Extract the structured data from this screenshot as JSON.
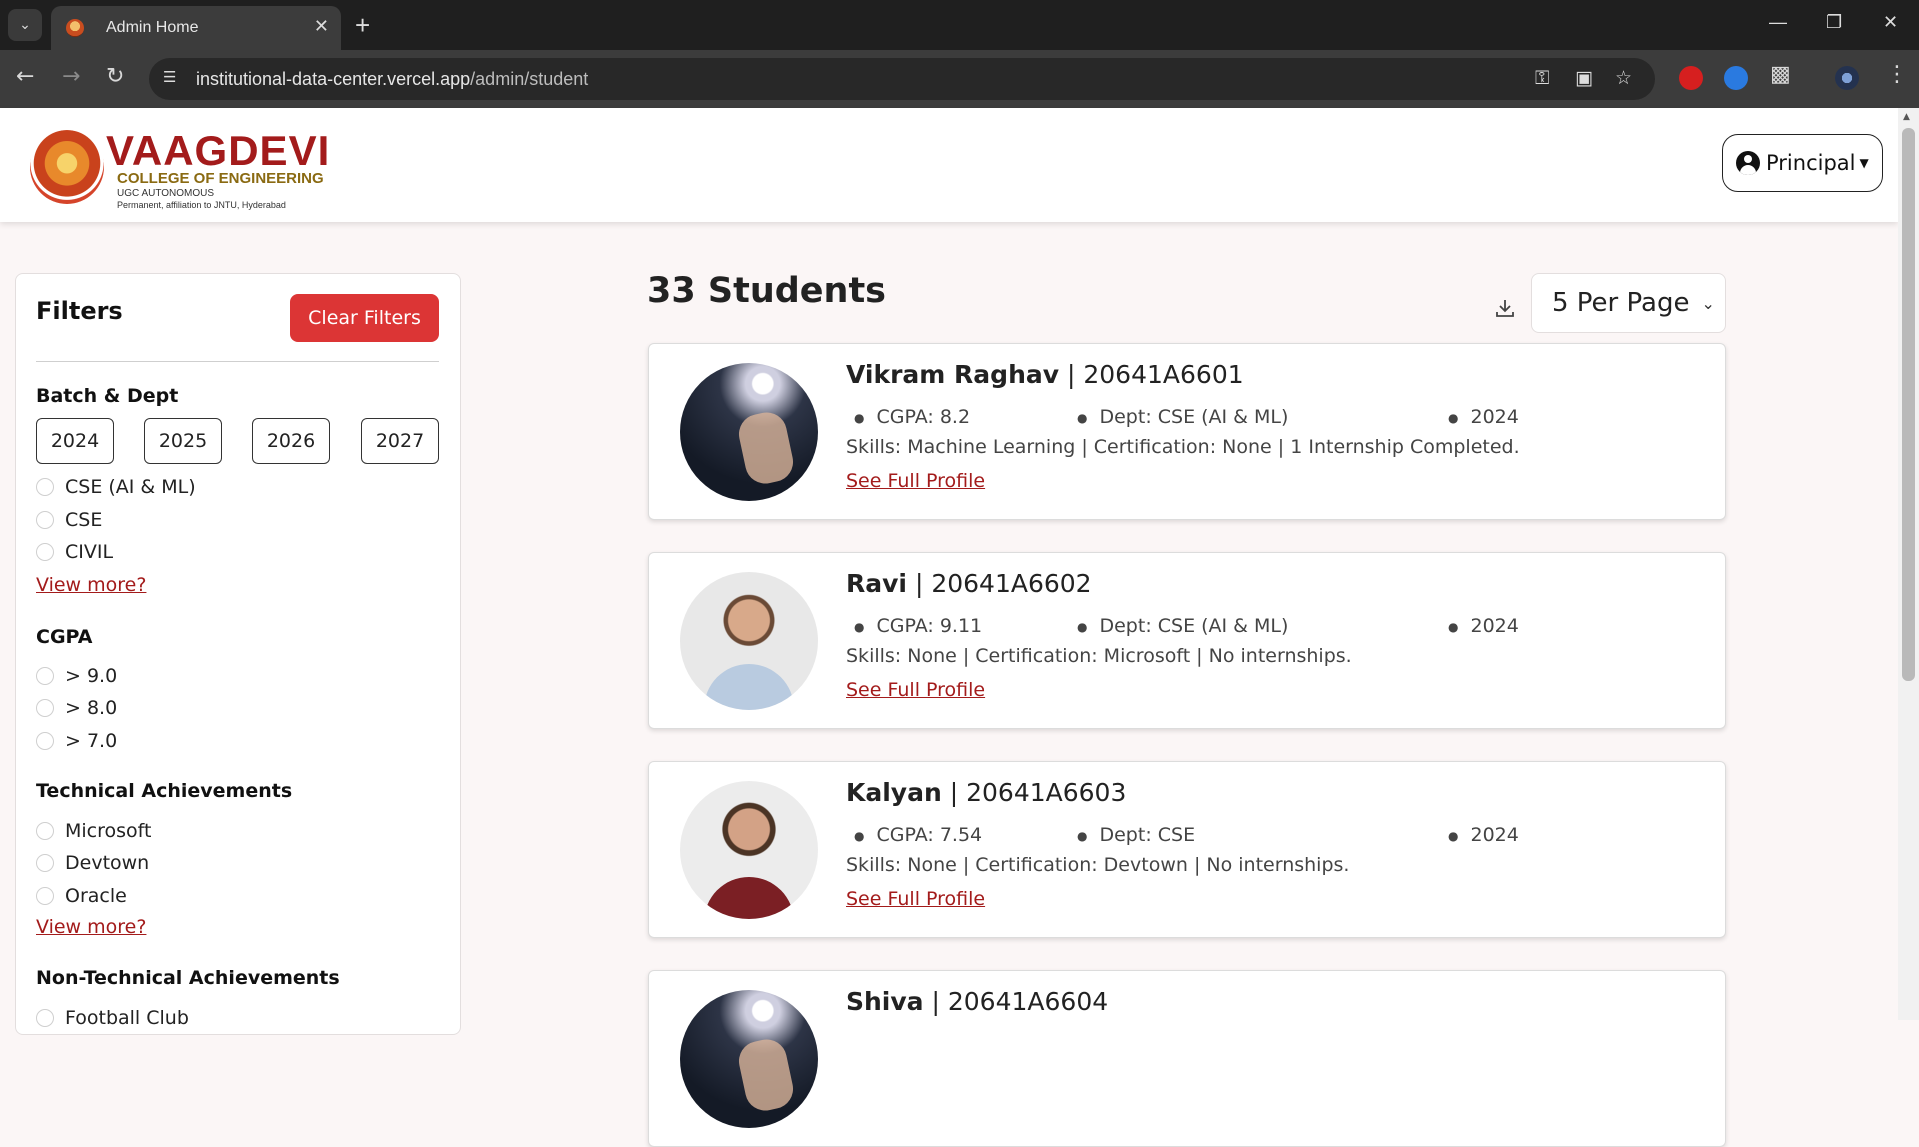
{
  "browser": {
    "tab_title": "Admin Home",
    "url_domain": "institutional-data-center.vercel.app",
    "url_path": "/admin/student"
  },
  "header": {
    "logo_title": "VAAGDEVI",
    "logo_subtitle": "COLLEGE OF ENGINEERING",
    "logo_ugc": "UGC AUTONOMOUS",
    "logo_affiliation": "Permanent, affiliation to JNTU, Hyderabad",
    "user_menu_label": "Principal"
  },
  "filters": {
    "title": "Filters",
    "clear_label": "Clear Filters",
    "batch_title": "Batch & Dept",
    "years": [
      "2024",
      "2025",
      "2026",
      "2027"
    ],
    "depts": [
      "CSE (AI & ML)",
      "CSE",
      "CIVIL"
    ],
    "view_more": "View more?",
    "cgpa_title": "CGPA",
    "cgpa_options": [
      "> 9.0",
      "> 8.0",
      "> 7.0"
    ],
    "tech_title": "Technical Achievements",
    "tech_options": [
      "Microsoft",
      "Devtown",
      "Oracle"
    ],
    "nontech_title": "Non-Technical Achievements",
    "nontech_options": [
      "Football Club"
    ]
  },
  "main": {
    "count_label": "33 Students",
    "per_page_label": "5 Per Page",
    "profile_link": "See Full Profile",
    "students": [
      {
        "name": "Vikram Raghav",
        "roll": "20641A6601",
        "cgpa": "CGPA: 8.2",
        "dept": "Dept: CSE (AI & ML)",
        "year": "2024",
        "details": "Skills: Machine Learning | Certification: None | 1 Internship Completed."
      },
      {
        "name": "Ravi",
        "roll": "20641A6602",
        "cgpa": "CGPA: 9.11",
        "dept": "Dept: CSE (AI & ML)",
        "year": "2024",
        "details": "Skills: None | Certification: Microsoft | No internships."
      },
      {
        "name": "Kalyan",
        "roll": "20641A6603",
        "cgpa": "CGPA: 7.54",
        "dept": "Dept: CSE",
        "year": "2024",
        "details": "Skills: None | Certification: Devtown | No internships."
      },
      {
        "name": "Shiva",
        "roll": "20641A6604"
      }
    ]
  },
  "colors": {
    "brand_red": "#a31b1b",
    "clear_button": "#dc3535",
    "logo_gold": "#8a6a12"
  }
}
